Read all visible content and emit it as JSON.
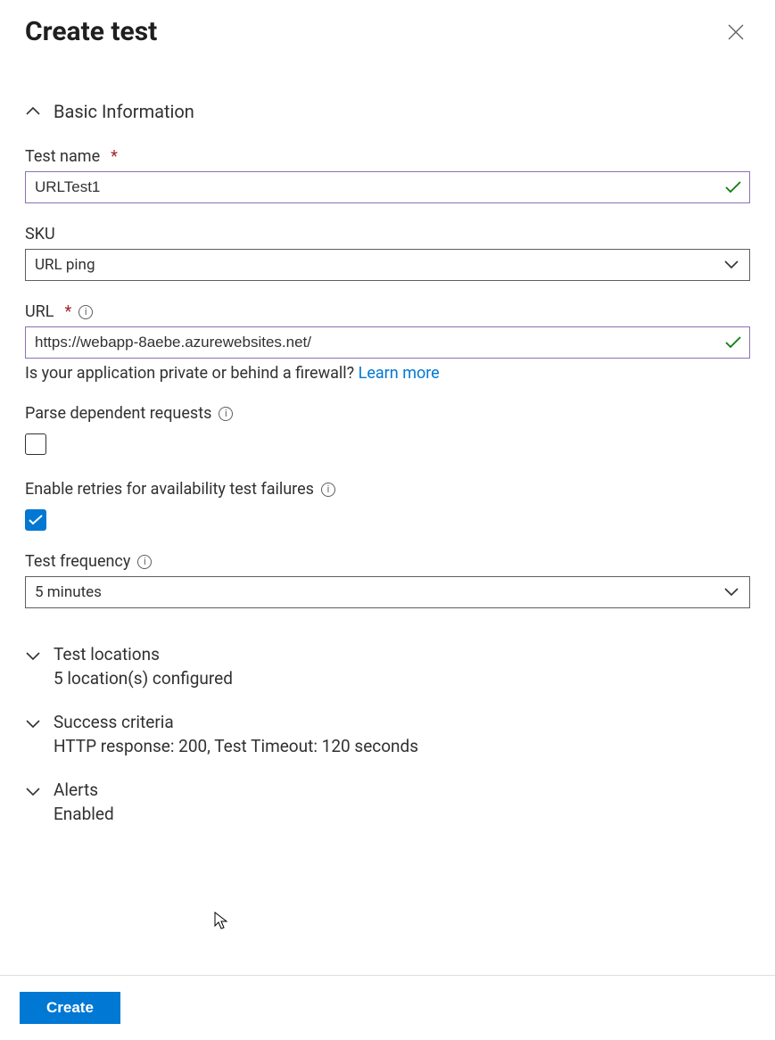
{
  "header": {
    "title": "Create test"
  },
  "sections": {
    "basic": {
      "title": "Basic Information",
      "fields": {
        "testName": {
          "label": "Test name",
          "value": "URLTest1",
          "required": true
        },
        "sku": {
          "label": "SKU",
          "value": "URL ping"
        },
        "url": {
          "label": "URL",
          "value": "https://webapp-8aebe.azurewebsites.net/",
          "required": true,
          "helpText": "Is your application private or behind a firewall?",
          "helpLink": "Learn more"
        },
        "parseRequests": {
          "label": "Parse dependent requests",
          "checked": false
        },
        "enableRetries": {
          "label": "Enable retries for availability test failures",
          "checked": true
        },
        "testFrequency": {
          "label": "Test frequency",
          "value": "5 minutes"
        }
      }
    },
    "locations": {
      "title": "Test locations",
      "summary": "5 location(s) configured"
    },
    "success": {
      "title": "Success criteria",
      "summary": "HTTP response: 200, Test Timeout: 120 seconds"
    },
    "alerts": {
      "title": "Alerts",
      "summary": "Enabled"
    }
  },
  "footer": {
    "createLabel": "Create"
  }
}
